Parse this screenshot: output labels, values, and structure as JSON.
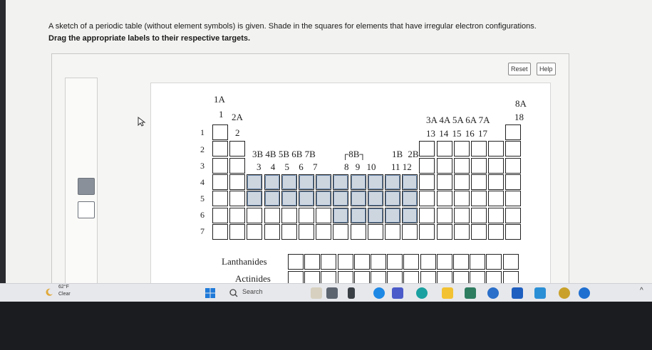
{
  "instructions": {
    "line1": "A sketch of a periodic table (without element symbols) is given. Shade in the squares for elements that have irregular electron configurations.",
    "line2": "Drag the appropriate labels to their respective targets."
  },
  "buttons": {
    "reset": "Reset",
    "help": "Help"
  },
  "table": {
    "g1a": "1A",
    "g1": "1",
    "g2a": "2A",
    "g2": "2",
    "g3b_7b": "3B 4B 5B 6B 7B",
    "g3_7": "3 4 5 6 7",
    "g8b": "┌8B┐",
    "g8_10": "8 9 10",
    "g1b2b": "1B 2B",
    "g11_12": "11 12",
    "g3a_7a": "3A 4A 5A 6A 7A",
    "g13_17": "13 14 15 16 17",
    "g8a": "8A",
    "g18": "18",
    "periods": [
      "1",
      "2",
      "3",
      "4",
      "5",
      "6",
      "7"
    ],
    "lanthanides": "Lanthanides",
    "actinides": "Actinides"
  },
  "taskbar": {
    "temp": "62°F",
    "condition": "Clear",
    "search_placeholder": "Search"
  }
}
